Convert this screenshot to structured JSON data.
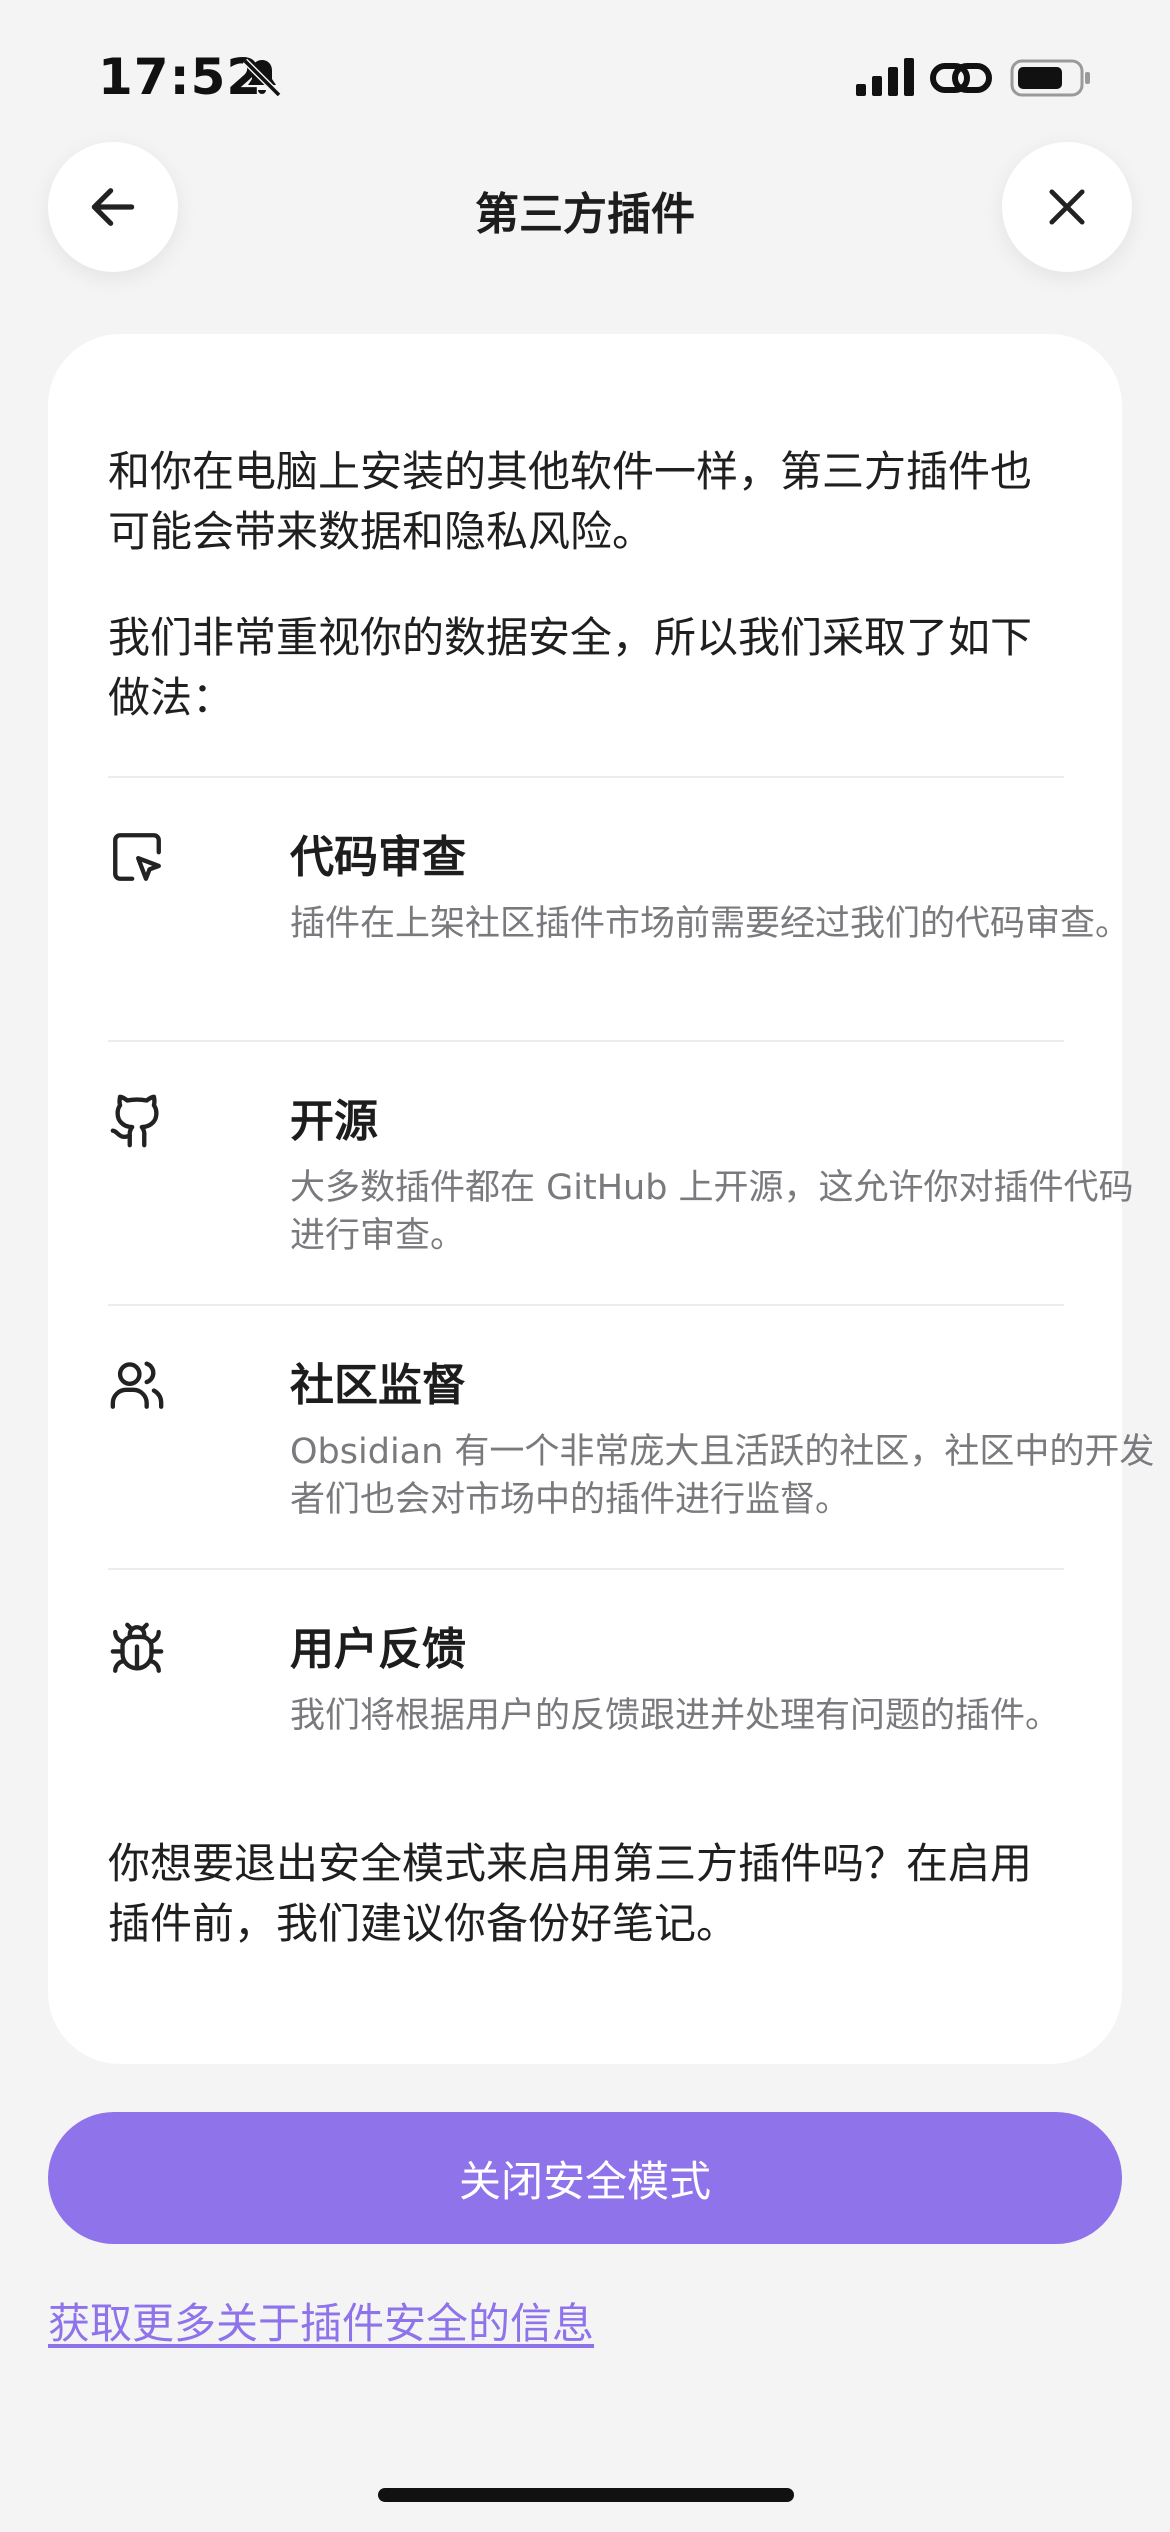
{
  "status_bar": {
    "time": "17:52",
    "icons": [
      "bell-slash-icon",
      "signal-icon",
      "link-icon",
      "battery-icon"
    ]
  },
  "header": {
    "title": "第三方插件",
    "back_icon": "arrow-left-icon",
    "close_icon": "close-icon"
  },
  "card": {
    "intro_paragraphs": [
      "和你在电脑上安装的其他软件一样，第三方插件也可能会带来数据和隐私风险。",
      "我们非常重视你的数据安全，所以我们采取了如下做法："
    ],
    "features": [
      {
        "icon": "code-review-cursor-icon",
        "title": "代码审查",
        "description": "插件在上架社区插件市场前需要经过我们的代码审查。"
      },
      {
        "icon": "github-icon",
        "title": "开源",
        "description": "大多数插件都在 GitHub 上开源，这允许你对插件代码进行审查。"
      },
      {
        "icon": "users-icon",
        "title": "社区监督",
        "description": "Obsidian 有一个非常庞大且活跃的社区，社区中的开发者们也会对市场中的插件进行监督。"
      },
      {
        "icon": "bug-icon",
        "title": "用户反馈",
        "description": "我们将根据用户的反馈跟进并处理有问题的插件。"
      }
    ],
    "outro": "你想要退出安全模式来启用第三方插件吗？在启用插件前，我们建议你备份好笔记。"
  },
  "actions": {
    "primary_button": "关闭安全模式",
    "more_info_link": "获取更多关于插件安全的信息"
  },
  "colors": {
    "accent": "#8e73ea",
    "background": "#f4f4f5",
    "card": "#ffffff",
    "muted_text": "#7a7a7e"
  }
}
